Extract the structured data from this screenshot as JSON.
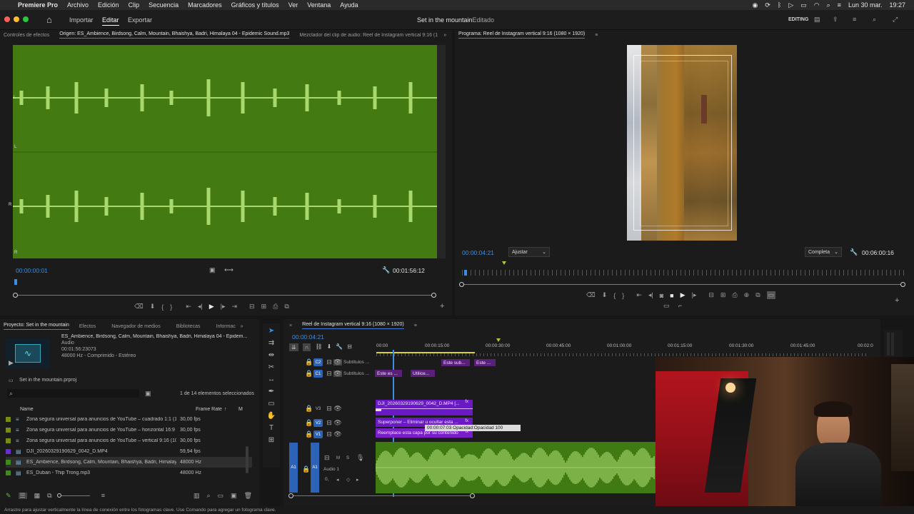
{
  "menubar": {
    "apple": "",
    "items": [
      "Premiere Pro",
      "Archivo",
      "Edición",
      "Clip",
      "Secuencia",
      "Marcadores",
      "Gráficos y títulos",
      "Ver",
      "Ventana",
      "Ayuda"
    ],
    "date": "Lun 30 mar.",
    "time": "19:27"
  },
  "toolbar": {
    "home": "⌂",
    "tabs": [
      "Importar",
      "Editar",
      "Exportar"
    ],
    "active_tab": "Editar",
    "title": "Set in the mountain",
    "status": "- Editado",
    "workspace": "EDITING"
  },
  "source_monitor": {
    "tabs": [
      "Controles de efectos",
      "Origen: ES_Ambience, Birdsong, Calm, Mountain, Bhaishya, Badri, Himalaya 04 - Epidemic Sound.mp3",
      "Mezclador del clip de audio: Reel de Instagram vertical 9:16 (1"
    ],
    "channel_labels": [
      "L",
      "L",
      "R",
      "R"
    ],
    "timecode_in": "00:00:00:01",
    "timecode_dur": "00:01:56:12"
  },
  "program_monitor": {
    "tab": "Programa: Reel de Instagram vertical 9:16 (1080 × 1920)",
    "timecode": "00:00:04:21",
    "fit": "Ajustar",
    "quality": "Completa",
    "duration": "00:06:00:16"
  },
  "project": {
    "tabs": [
      "Proyecto: Set in the mountain",
      "Efectos",
      "Navegador de medios",
      "Bibliotecas",
      "Informac"
    ],
    "preview_name": "ES_Ambience, Birdsong, Calm, Mountain, Bhaishya, Badri, Himalaya 04 - Epidem...",
    "preview_type": "Audio",
    "preview_dur": "00:01:56:23073",
    "preview_info": "48000 Hz - Comprimido - Estéreo",
    "project_file": "Set in the mountain.prproj",
    "count": "1 de 14 elementos seleccionados",
    "col_name": "Name",
    "col_fr": "Frame Rate",
    "col_m": "M",
    "rows": [
      {
        "name": "Zona segura universal para anuncios de YouTube – cuadrado 1:1 (10",
        "fr": "30,00 fps",
        "color": "#7a8a17",
        "icon": "≡"
      },
      {
        "name": "Zona segura universal para anuncios de YouTube – horizontal 16:9 (1",
        "fr": "30,00 fps",
        "color": "#7a8a17",
        "icon": "≡"
      },
      {
        "name": "Zona segura universal para anuncios de YouTube – vertical 9:16 (108",
        "fr": "30,00 fps",
        "color": "#7a8a17",
        "icon": "≡"
      },
      {
        "name": "DJI_20260329190629_0042_D.MP4",
        "fr": "59,94 fps",
        "color": "#6a2bd0",
        "icon": "▤"
      },
      {
        "name": "ES_Ambience, Birdsong, Calm, Mountain, Bhaishya, Badri, Himalaya",
        "fr": "48000 Hz",
        "color": "#3f8a1c",
        "icon": "▤"
      },
      {
        "name": "ES_Duban - Thip Trong.mp3",
        "fr": "48000 Hz",
        "color": "#3f8a1c",
        "icon": "▤"
      }
    ]
  },
  "timeline": {
    "tab": "Reel de Instagram vertical 9:16 (1080 × 1920)",
    "timecode": "00:00:04:21",
    "ruler": [
      "00:00",
      "00:00:15:00",
      "00:00:30:00",
      "00:00:45:00",
      "00:01:00:00",
      "00:01:15:00",
      "00:01:30:00",
      "00:01:45:00",
      "00:02:0"
    ],
    "tracks": [
      {
        "tag": "C2",
        "name": "Subtítulos ..."
      },
      {
        "tag": "C1",
        "name": "Subtítulos ..."
      },
      {
        "tag": "V3",
        "name": ""
      },
      {
        "tag": "V2",
        "name": ""
      },
      {
        "tag": "V1",
        "name": ""
      },
      {
        "tag": "A1",
        "name": "Audio 1"
      }
    ],
    "clips": {
      "c2a": "Este sub...",
      "c2b": "Este ...",
      "c1a": "Este es ...",
      "c1b": "Utilice...",
      "v3": "DJI_20260329190629_0042_D.MP4 [...",
      "v2": "Superponer – Eliminar u ocultar esta ...",
      "v1": "Reemplace esta capa por su contenido",
      "fx": "fx"
    },
    "tooltip": "00:00:07:03  Opacidad:Opacidad  100",
    "audio_m": "M",
    "audio_s": "S",
    "audio_vol": "0,"
  },
  "statusbar": "Arrastre para ajustar verticalmente la línea de conexión entre los fotogramas clave. Use Comando para agregar un fotograma clave."
}
